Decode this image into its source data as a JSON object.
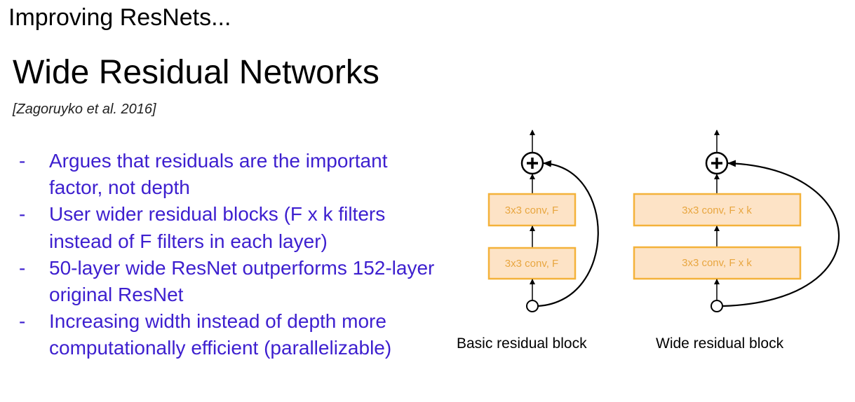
{
  "supertitle": "Improving ResNets...",
  "title": "Wide Residual Networks",
  "citation": "[Zagoruyko et al. 2016]",
  "bullets": [
    {
      "dash": "-",
      "text": "Argues that residuals are the important factor, not depth"
    },
    {
      "dash": "-",
      "text": "User wider residual blocks (F x k filters instead of F filters in each layer)"
    },
    {
      "dash": "-",
      "text": "50-layer wide ResNet outperforms 152-layer original ResNet"
    },
    {
      "dash": "-",
      "text": "Increasing width instead of depth more computationally efficient (parallelizable)"
    }
  ],
  "diagrams": {
    "basic": {
      "label": "Basic residual block",
      "layers": [
        "3x3 conv, F",
        "3x3 conv, F"
      ]
    },
    "wide": {
      "label": "Wide residual block",
      "layers": [
        "3x3 conv, F x k",
        "3x3 conv, F x k"
      ]
    }
  },
  "colors": {
    "bullet_text": "#3d1fcf",
    "box_fill": "#fde3c6",
    "box_stroke": "#f4b23a"
  }
}
